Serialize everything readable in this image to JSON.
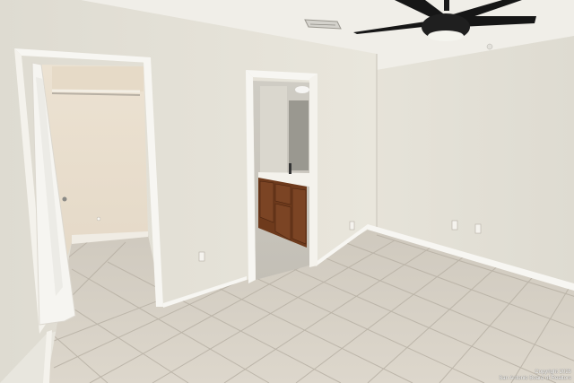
{
  "photo": {
    "subject": "empty-bedroom",
    "wall_color": "#e9e6dc",
    "ceiling_color": "#f0eee8",
    "floor_tile_color": "#d6d0c5",
    "vanity_color": "#6e3a1c"
  },
  "watermark": {
    "line1": "Copyright 2025",
    "line2": "San Antonio Board of Realtors"
  }
}
